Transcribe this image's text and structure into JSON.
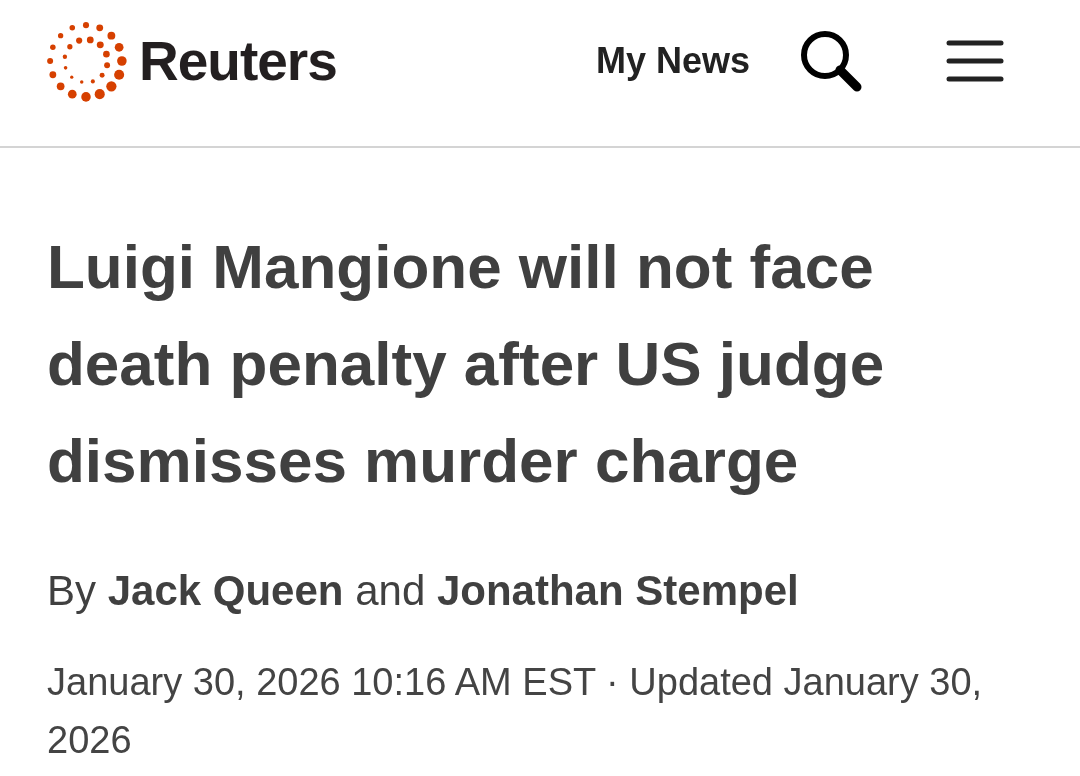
{
  "header": {
    "brand": "Reuters",
    "nav_link": "My News"
  },
  "article": {
    "headline": "Luigi Mangione will not face death penalty after US judge dismisses murder charge",
    "byline": "By **Jack Queen** and **Jonathan Stempel**",
    "timestamp": "January 30, 2026 10:16 AM EST · Updated January 30, 2026"
  }
}
